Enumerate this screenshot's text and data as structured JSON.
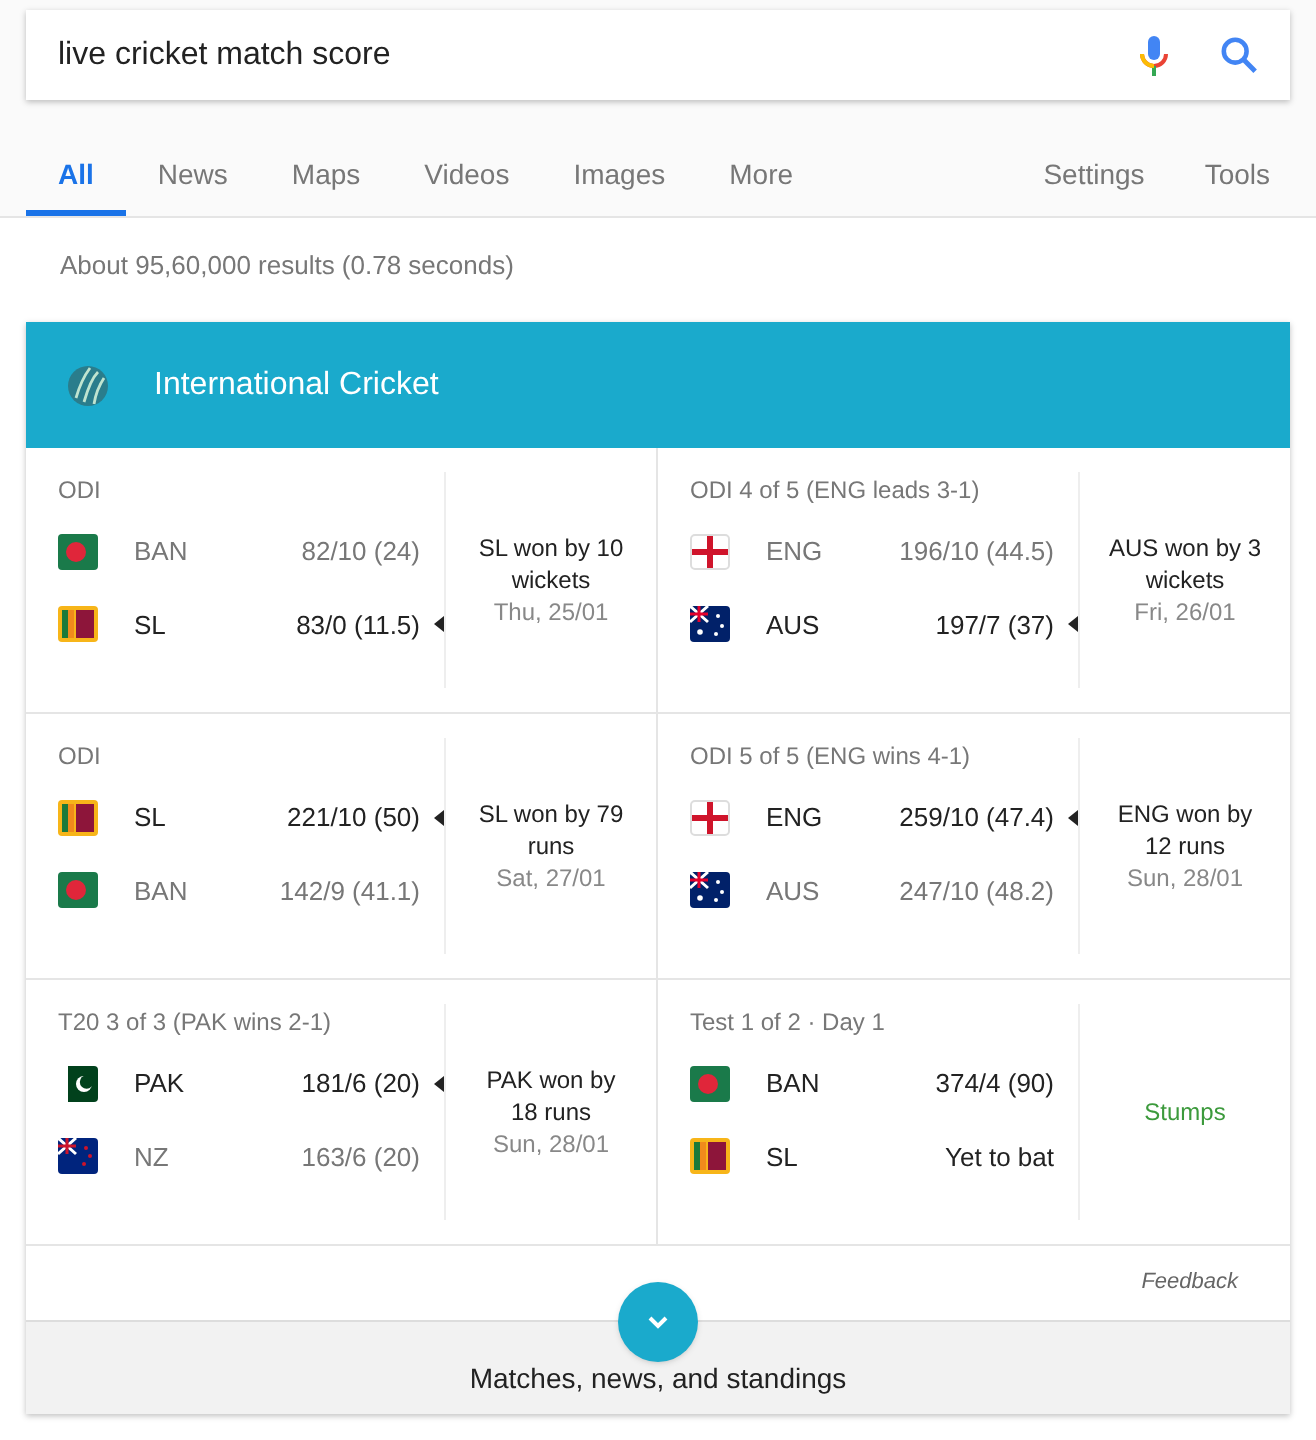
{
  "search": {
    "value": "live cricket match score"
  },
  "tabs": [
    {
      "label": "All",
      "selected": true
    },
    {
      "label": "News",
      "selected": false
    },
    {
      "label": "Maps",
      "selected": false
    },
    {
      "label": "Videos",
      "selected": false
    },
    {
      "label": "Images",
      "selected": false
    },
    {
      "label": "More",
      "selected": false
    }
  ],
  "tools": [
    "Settings",
    "Tools"
  ],
  "result_stats": "About 95,60,000 results (0.78 seconds)",
  "card": {
    "title": "International Cricket",
    "matches": [
      {
        "label": "ODI",
        "teams": [
          {
            "kind": "ban",
            "code": "BAN",
            "score": "82/10 (24)",
            "highlight": false,
            "arrow": false
          },
          {
            "kind": "sl",
            "code": "SL",
            "score": "83/0 (11.5)",
            "highlight": true,
            "arrow": true
          }
        ],
        "kind": "result",
        "result": "SL won by 10 wickets",
        "date": "Thu, 25/01"
      },
      {
        "label": "ODI 4 of 5 (ENG leads 3-1)",
        "teams": [
          {
            "kind": "eng",
            "code": "ENG",
            "score": "196/10 (44.5)",
            "highlight": false,
            "arrow": false
          },
          {
            "kind": "aus",
            "code": "AUS",
            "score": "197/7 (37)",
            "highlight": true,
            "arrow": true
          }
        ],
        "kind": "result",
        "result": "AUS won by 3 wickets",
        "date": "Fri, 26/01"
      },
      {
        "label": "ODI",
        "teams": [
          {
            "kind": "sl",
            "code": "SL",
            "score": "221/10 (50)",
            "highlight": true,
            "arrow": true
          },
          {
            "kind": "ban",
            "code": "BAN",
            "score": "142/9 (41.1)",
            "highlight": false,
            "arrow": false
          }
        ],
        "kind": "result",
        "result": "SL won by 79 runs",
        "date": "Sat, 27/01"
      },
      {
        "label": "ODI 5 of 5 (ENG wins 4-1)",
        "teams": [
          {
            "kind": "eng",
            "code": "ENG",
            "score": "259/10 (47.4)",
            "highlight": true,
            "arrow": true
          },
          {
            "kind": "aus",
            "code": "AUS",
            "score": "247/10 (48.2)",
            "highlight": false,
            "arrow": false
          }
        ],
        "kind": "result",
        "result": "ENG won by 12 runs",
        "date": "Sun, 28/01"
      },
      {
        "label": "T20 3 of 3 (PAK wins 2-1)",
        "teams": [
          {
            "kind": "pak",
            "code": "PAK",
            "score": "181/6 (20)",
            "highlight": true,
            "arrow": true
          },
          {
            "kind": "nz",
            "code": "NZ",
            "score": "163/6 (20)",
            "highlight": false,
            "arrow": false
          }
        ],
        "kind": "result",
        "result": "PAK won by 18 runs",
        "date": "Sun, 28/01"
      },
      {
        "label": "Test 1 of 2 · Day 1",
        "teams": [
          {
            "kind": "ban",
            "code": "BAN",
            "score": "374/4 (90)",
            "highlight": true,
            "arrow": false
          },
          {
            "kind": "sl",
            "code": "SL",
            "score": "Yet to bat",
            "highlight": true,
            "arrow": false
          }
        ],
        "kind": "status",
        "status": "Stumps"
      }
    ],
    "feedback": "Feedback",
    "more": "Matches, news, and standings"
  }
}
